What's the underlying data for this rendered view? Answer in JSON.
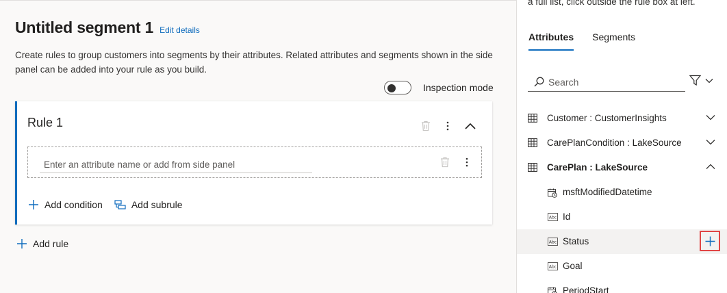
{
  "segment": {
    "title": "Untitled segment 1",
    "edit_link": "Edit details",
    "description": "Create rules to group customers into segments by their attributes. Related attributes and segments shown in the side panel can be added into your rule as you build.",
    "inspection_label": "Inspection mode",
    "inspection_on": false
  },
  "rule": {
    "title": "Rule 1",
    "condition_placeholder": "Enter an attribute name or add from side panel",
    "add_condition": "Add condition",
    "add_subrule": "Add subrule"
  },
  "add_rule": "Add rule",
  "side_panel": {
    "hint": "a full list, click outside the rule box at left.",
    "tabs": [
      {
        "label": "Attributes",
        "active": true
      },
      {
        "label": "Segments",
        "active": false
      }
    ],
    "search_placeholder": "Search",
    "entities": [
      {
        "label": "Customer : CustomerInsights",
        "expanded": false
      },
      {
        "label": "CarePlanCondition : LakeSource",
        "expanded": false
      },
      {
        "label": "CarePlan : LakeSource",
        "expanded": true
      }
    ],
    "attributes": [
      {
        "label": "msftModifiedDatetime",
        "icon": "datetime-icon"
      },
      {
        "label": "Id",
        "icon": "text-icon"
      },
      {
        "label": "Status",
        "icon": "text-icon",
        "hovered": true
      },
      {
        "label": "Goal",
        "icon": "text-icon"
      },
      {
        "label": "PeriodStart",
        "icon": "datetime-icon"
      }
    ]
  },
  "colors": {
    "accent": "#0f6cbd",
    "highlight_box": "#e04545"
  }
}
